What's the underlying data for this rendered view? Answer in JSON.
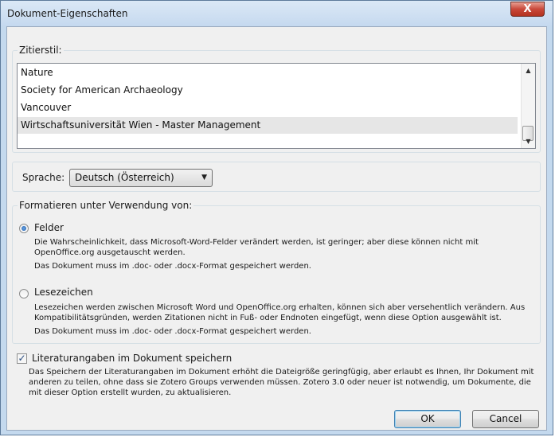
{
  "window": {
    "title": "Dokument-Eigenschaften",
    "close_glyph": "X"
  },
  "citation_style": {
    "legend": "Zitierstil:",
    "items": [
      "Nature",
      "Society for American Archaeology",
      "Vancouver",
      "Wirtschaftsuniversität Wien - Master Management"
    ],
    "selected_index": 3
  },
  "language": {
    "label": "Sprache:",
    "value": "Deutsch (Österreich)"
  },
  "format": {
    "legend": "Formatieren unter Verwendung von:",
    "fields": {
      "label": "Felder",
      "checked": true,
      "desc1a": "Die Wahrscheinlichkeit, dass Microsoft-Word-Felder verändert werden, ist geringer; aber diese können nicht mit",
      "desc1b": "OpenOffice.org ausgetauscht werden.",
      "desc2": "Das Dokument muss im .doc- oder .docx-Format gespeichert werden."
    },
    "bookmarks": {
      "label": "Lesezeichen",
      "checked": false,
      "desc1a": "Lesezeichen werden zwischen Microsoft Word und OpenOffice.org erhalten, können sich aber versehentlich verändern. Aus",
      "desc1b": "Kompatibilitätsgründen, werden Zitationen nicht in Fuß- oder Endnoten eingefügt, wenn diese Option ausgewählt ist.",
      "desc2": "Das Dokument muss im .doc- oder .docx-Format gespeichert werden."
    }
  },
  "store_refs": {
    "label": "Literaturangaben im Dokument speichern",
    "checked": true,
    "desc1": "Das Speichern der Literaturangaben im Dokument erhöht die Dateigröße geringfügig, aber erlaubt es Ihnen, Ihr Dokument mit",
    "desc2": "anderen zu teilen, ohne dass sie Zotero Groups verwenden müssen. Zotero 3.0 oder neuer ist notwendig, um Dokumente, die",
    "desc3": "mit dieser Option erstellt wurden, zu aktualisieren."
  },
  "buttons": {
    "ok": "OK",
    "cancel": "Cancel"
  },
  "icons": {
    "check": "✓",
    "dropdown": "▼",
    "scroll_up": "▲",
    "scroll_down": "▼"
  },
  "colors": {
    "accent": "#1e5aa8",
    "title_bar": "#c4d9ee",
    "close_button": "#c9483a"
  }
}
